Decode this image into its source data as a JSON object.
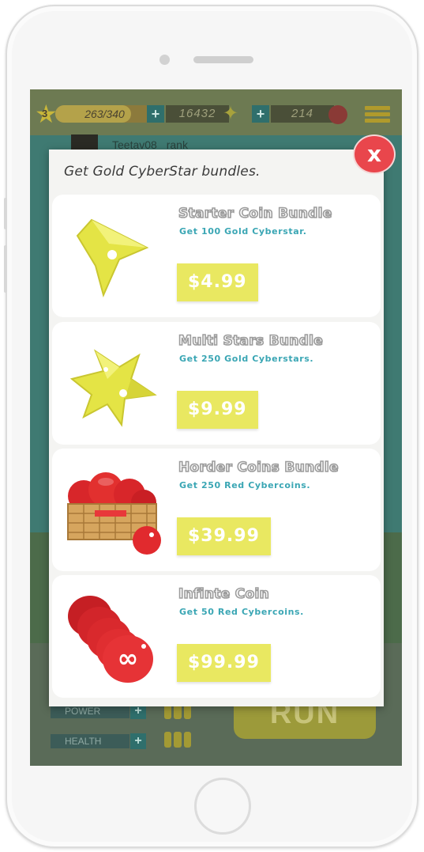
{
  "hud": {
    "level": "3",
    "xp_text": "263/340",
    "xp_progress": 0.77,
    "gold_stars": "16432",
    "red_coins": "214"
  },
  "background": {
    "player_name": "Teetav08",
    "rank_label": "rank",
    "stats": [
      "POWER",
      "HEALTH"
    ],
    "run_label": "RUN"
  },
  "modal": {
    "title": "Get Gold CyberStar bundles.",
    "close_label": "x",
    "bundles": [
      {
        "name": "Starter Coin Bundle",
        "description": "Get 100 Gold Cyberstar.",
        "price": "$4.99",
        "icon": "single-gold-star-icon"
      },
      {
        "name": "Multi Stars Bundle",
        "description": "Get 250 Gold Cyberstars.",
        "price": "$9.99",
        "icon": "multi-gold-stars-icon"
      },
      {
        "name": "Horder Coins Bundle",
        "description": "Get 250 Red Cybercoins.",
        "price": "$39.99",
        "icon": "basket-red-coins-icon"
      },
      {
        "name": "Infinte Coin",
        "description": "Get 50 Red Cybercoins.",
        "price": "$99.99",
        "icon": "infinite-red-coin-icon"
      }
    ]
  },
  "colors": {
    "accent_yellow": "#e9e861",
    "desc_teal": "#3aa6b4",
    "close_red": "#e9464c"
  }
}
